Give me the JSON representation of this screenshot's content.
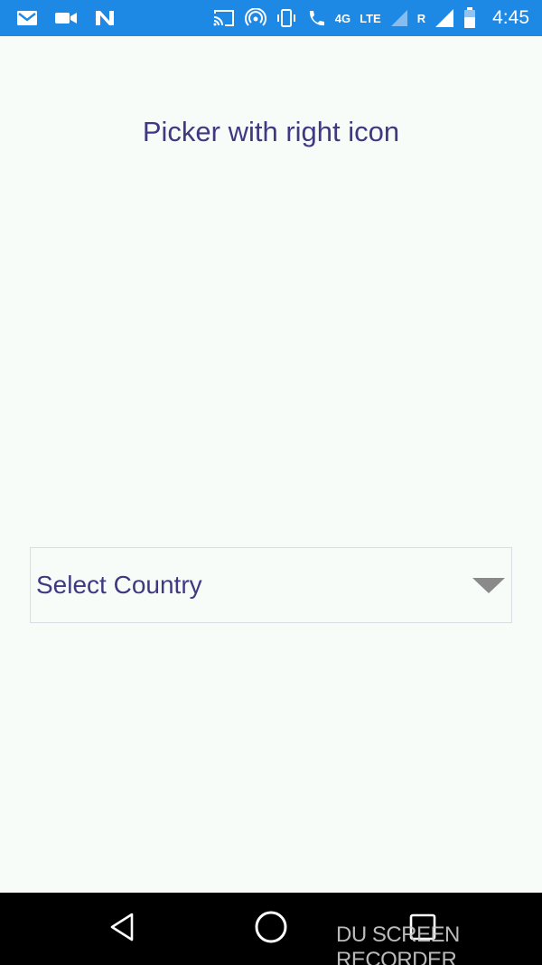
{
  "status_bar": {
    "left_icons": [
      "gmail-icon",
      "video-icon",
      "n-app-icon"
    ],
    "right_icons": [
      "cast-icon",
      "hotspot-icon",
      "vibrate-icon",
      "wifi-calling-icon"
    ],
    "network_4g": "4G",
    "network_lte": "LTE",
    "roaming": "R",
    "time": "4:45",
    "background_color": "#1e88e5"
  },
  "page": {
    "title": "Picker with right icon",
    "background_color": "#f8fcf9",
    "text_color": "#3e3a82"
  },
  "picker": {
    "selected_label": "Select Country",
    "icon": "triangle-down-icon",
    "icon_color": "#8a8a8a"
  },
  "nav_bar": {
    "buttons": [
      "back-icon",
      "home-icon",
      "recents-icon"
    ]
  },
  "watermark": {
    "text": "DU SCREEN RECORDER"
  }
}
